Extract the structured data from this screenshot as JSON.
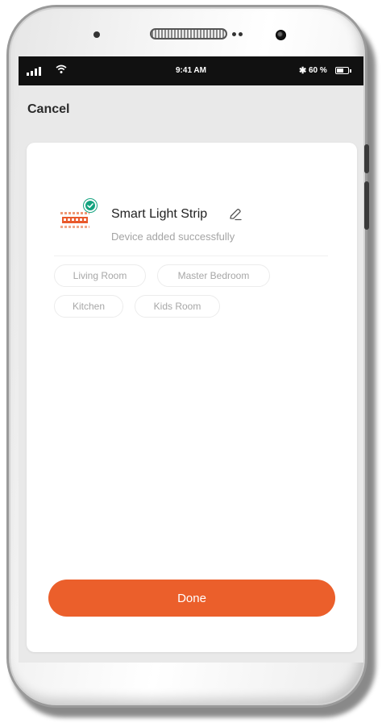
{
  "status_bar": {
    "time": "9:41 AM",
    "battery_text": "60 %",
    "battery_level_percent": 60,
    "bluetooth_symbol": "✱"
  },
  "header": {
    "cancel_label": "Cancel"
  },
  "device": {
    "name": "Smart Light Strip",
    "status": "Device added successfully",
    "thumbnail_icon": "light-strip-icon",
    "badge_icon": "checkmark-icon",
    "edit_icon": "pencil-icon"
  },
  "rooms": [
    {
      "label": "Living Room"
    },
    {
      "label": "Master Bedroom"
    },
    {
      "label": "Kitchen"
    },
    {
      "label": "Kids Room"
    }
  ],
  "footer": {
    "done_label": "Done"
  },
  "colors": {
    "accent": "#eb5f2b",
    "success": "#14a37f",
    "muted_text": "#a4a4a4"
  }
}
